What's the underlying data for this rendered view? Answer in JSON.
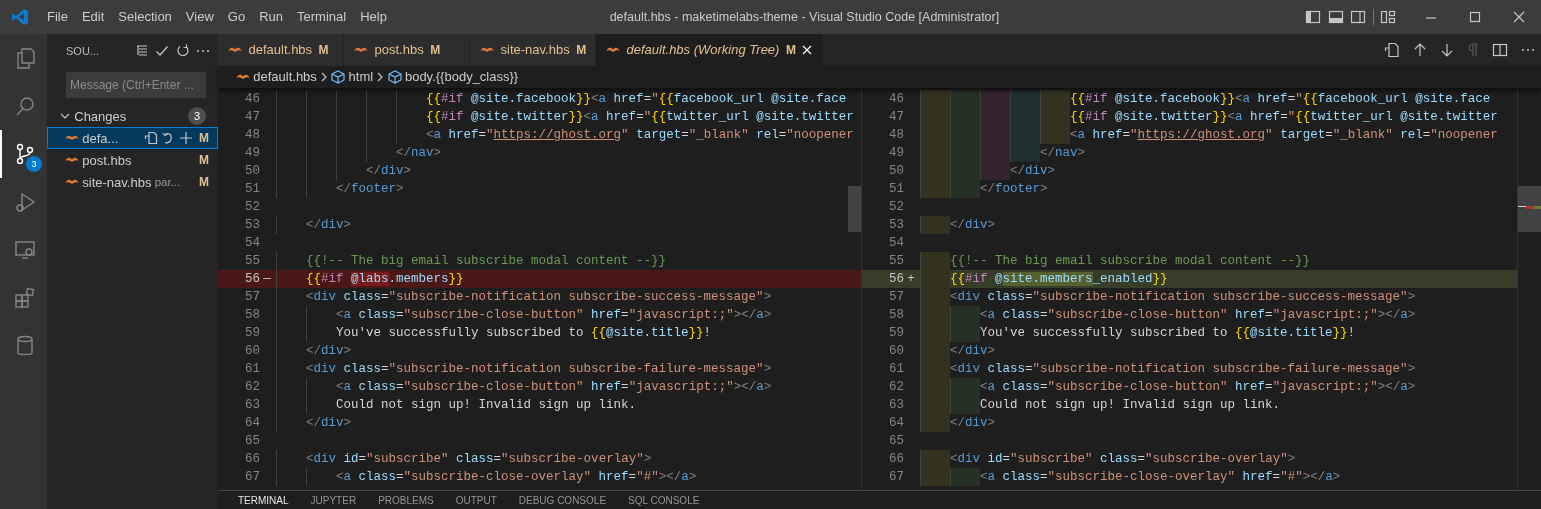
{
  "title_bar": {
    "menus": [
      "File",
      "Edit",
      "Selection",
      "View",
      "Go",
      "Run",
      "Terminal",
      "Help"
    ],
    "title": "default.hbs - maketimelabs-theme - Visual Studio Code [Administrator]"
  },
  "activity_bar": {
    "items": [
      {
        "selected": false
      },
      {
        "selected": false
      },
      {
        "selected": true,
        "badge": "3"
      },
      {
        "selected": false
      },
      {
        "selected": false
      },
      {
        "selected": false
      },
      {
        "selected": false
      }
    ]
  },
  "sidebar": {
    "title": "SOU...",
    "message": {
      "placeholder": "Message (Ctrl+Enter ..."
    },
    "section": {
      "label": "Changes",
      "expanded": true,
      "count": "3",
      "files": [
        {
          "name": "defa...",
          "status": "M",
          "selected": true
        },
        {
          "name": "post.hbs",
          "status": "M",
          "selected": false
        },
        {
          "name": "site-nav.hbs",
          "detail": "par...",
          "status": "M",
          "selected": false
        }
      ]
    }
  },
  "tabs": [
    {
      "label": "default.hbs",
      "status": "M",
      "selected": false,
      "preview": false
    },
    {
      "label": "post.hbs",
      "status": "M",
      "selected": false,
      "preview": false
    },
    {
      "label": "site-nav.hbs",
      "status": "M",
      "selected": false,
      "preview": false
    },
    {
      "label": "default.hbs (Working Tree)",
      "status": "M",
      "selected": true,
      "preview": true
    }
  ],
  "breadcrumbs": [
    {
      "label": "default.hbs",
      "kind": "file"
    },
    {
      "label": "html",
      "kind": "symbol"
    },
    {
      "label": "body.{{body_class}}",
      "kind": "symbol"
    }
  ],
  "diff": {
    "left": {
      "indent_rainbow": false,
      "lines": [
        {
          "number": "46",
          "kind": "unchanged",
          "tokens": [
            {
              "kind": "brace",
              "text": "                    {{"
            },
            {
              "kind": "keyword",
              "text": "#if"
            },
            {
              "kind": "var",
              "text": " @site.facebook"
            },
            {
              "kind": "brace",
              "text": "}}"
            },
            {
              "kind": "punct",
              "text": "<"
            },
            {
              "kind": "tag",
              "text": "a"
            },
            {
              "kind": "attr",
              "text": " href"
            },
            {
              "kind": "plain",
              "text": "="
            },
            {
              "kind": "string",
              "text": "\""
            },
            {
              "kind": "brace",
              "text": "{{"
            },
            {
              "kind": "var",
              "text": "facebook_url @site.face"
            }
          ]
        },
        {
          "number": "47",
          "kind": "unchanged",
          "tokens": [
            {
              "kind": "brace",
              "text": "                    {{"
            },
            {
              "kind": "keyword",
              "text": "#if"
            },
            {
              "kind": "var",
              "text": " @site.twitter"
            },
            {
              "kind": "brace",
              "text": "}}"
            },
            {
              "kind": "punct",
              "text": "<"
            },
            {
              "kind": "tag",
              "text": "a"
            },
            {
              "kind": "attr",
              "text": " href"
            },
            {
              "kind": "plain",
              "text": "="
            },
            {
              "kind": "string",
              "text": "\""
            },
            {
              "kind": "brace",
              "text": "{{"
            },
            {
              "kind": "var",
              "text": "twitter_url @site.twitter"
            }
          ]
        },
        {
          "number": "48",
          "kind": "unchanged",
          "tokens": [
            {
              "kind": "punct",
              "text": "                    <"
            },
            {
              "kind": "tag",
              "text": "a"
            },
            {
              "kind": "attr",
              "text": " href"
            },
            {
              "kind": "plain",
              "text": "="
            },
            {
              "kind": "string",
              "text": "\""
            },
            {
              "kind": "link",
              "text": "https://ghost.org"
            },
            {
              "kind": "string",
              "text": "\""
            },
            {
              "kind": "attr",
              "text": " target"
            },
            {
              "kind": "plain",
              "text": "="
            },
            {
              "kind": "string",
              "text": "\"_blank\""
            },
            {
              "kind": "attr",
              "text": " rel"
            },
            {
              "kind": "plain",
              "text": "="
            },
            {
              "kind": "string",
              "text": "\"noopener"
            }
          ]
        },
        {
          "number": "49",
          "kind": "unchanged",
          "tokens": [
            {
              "kind": "punct",
              "text": "                </"
            },
            {
              "kind": "tag",
              "text": "nav"
            },
            {
              "kind": "punct",
              "text": ">"
            }
          ]
        },
        {
          "number": "50",
          "kind": "unchanged",
          "tokens": [
            {
              "kind": "punct",
              "text": "            </"
            },
            {
              "kind": "tag",
              "text": "div"
            },
            {
              "kind": "punct",
              "text": ">"
            }
          ]
        },
        {
          "number": "51",
          "kind": "unchanged",
          "tokens": [
            {
              "kind": "punct",
              "text": "        </"
            },
            {
              "kind": "tag",
              "text": "footer"
            },
            {
              "kind": "punct",
              "text": ">"
            }
          ]
        },
        {
          "number": "52",
          "kind": "unchanged"
        },
        {
          "number": "53",
          "kind": "unchanged",
          "tokens": [
            {
              "kind": "punct",
              "text": "    </"
            },
            {
              "kind": "tag",
              "text": "div"
            },
            {
              "kind": "punct",
              "text": ">"
            }
          ]
        },
        {
          "number": "54",
          "kind": "unchanged"
        },
        {
          "number": "55",
          "kind": "unchanged",
          "tokens": [
            {
              "kind": "comment",
              "text": "    {{!-- The big email subscribe modal content --}}"
            }
          ]
        },
        {
          "number": "56",
          "kind": "removed",
          "marker": "—",
          "tokens": [
            {
              "kind": "brace",
              "text": "    {{"
            },
            {
              "kind": "keyword",
              "text": "#if "
            },
            {
              "kind": "deleted",
              "text": "@labs"
            },
            {
              "kind": "var",
              "text": ".members"
            },
            {
              "kind": "brace",
              "text": "}}"
            }
          ]
        },
        {
          "number": "57",
          "kind": "unchanged",
          "tokens": [
            {
              "kind": "punct",
              "text": "    <"
            },
            {
              "kind": "tag",
              "text": "div"
            },
            {
              "kind": "attr",
              "text": " class"
            },
            {
              "kind": "plain",
              "text": "="
            },
            {
              "kind": "string",
              "text": "\"subscribe-notification subscribe-success-message\""
            },
            {
              "kind": "punct",
              "text": ">"
            }
          ]
        },
        {
          "number": "58",
          "kind": "unchanged",
          "tokens": [
            {
              "kind": "punct",
              "text": "        <"
            },
            {
              "kind": "tag",
              "text": "a"
            },
            {
              "kind": "attr",
              "text": " class"
            },
            {
              "kind": "plain",
              "text": "="
            },
            {
              "kind": "string",
              "text": "\"subscribe-close-button\""
            },
            {
              "kind": "attr",
              "text": " href"
            },
            {
              "kind": "plain",
              "text": "="
            },
            {
              "kind": "string",
              "text": "\"javascript:;\""
            },
            {
              "kind": "punct",
              "text": "></"
            },
            {
              "kind": "tag",
              "text": "a"
            },
            {
              "kind": "punct",
              "text": ">"
            }
          ]
        },
        {
          "number": "59",
          "kind": "unchanged",
          "tokens": [
            {
              "kind": "plain",
              "text": "        You've successfully subscribed to "
            },
            {
              "kind": "brace",
              "text": "{{"
            },
            {
              "kind": "var",
              "text": "@site.title"
            },
            {
              "kind": "brace",
              "text": "}}"
            },
            {
              "kind": "plain",
              "text": "!"
            }
          ]
        },
        {
          "number": "60",
          "kind": "unchanged",
          "tokens": [
            {
              "kind": "punct",
              "text": "    </"
            },
            {
              "kind": "tag",
              "text": "div"
            },
            {
              "kind": "punct",
              "text": ">"
            }
          ]
        },
        {
          "number": "61",
          "kind": "unchanged",
          "tokens": [
            {
              "kind": "punct",
              "text": "    <"
            },
            {
              "kind": "tag",
              "text": "div"
            },
            {
              "kind": "attr",
              "text": " class"
            },
            {
              "kind": "plain",
              "text": "="
            },
            {
              "kind": "string",
              "text": "\"subscribe-notification subscribe-failure-message\""
            },
            {
              "kind": "punct",
              "text": ">"
            }
          ]
        },
        {
          "number": "62",
          "kind": "unchanged",
          "tokens": [
            {
              "kind": "punct",
              "text": "        <"
            },
            {
              "kind": "tag",
              "text": "a"
            },
            {
              "kind": "attr",
              "text": " class"
            },
            {
              "kind": "plain",
              "text": "="
            },
            {
              "kind": "string",
              "text": "\"subscribe-close-button\""
            },
            {
              "kind": "attr",
              "text": " href"
            },
            {
              "kind": "plain",
              "text": "="
            },
            {
              "kind": "string",
              "text": "\"javascript:;\""
            },
            {
              "kind": "punct",
              "text": "></"
            },
            {
              "kind": "tag",
              "text": "a"
            },
            {
              "kind": "punct",
              "text": ">"
            }
          ]
        },
        {
          "number": "63",
          "kind": "unchanged",
          "tokens": [
            {
              "kind": "plain",
              "text": "        Could not sign up! Invalid sign up link."
            }
          ]
        },
        {
          "number": "64",
          "kind": "unchanged",
          "tokens": [
            {
              "kind": "punct",
              "text": "    </"
            },
            {
              "kind": "tag",
              "text": "div"
            },
            {
              "kind": "punct",
              "text": ">"
            }
          ]
        },
        {
          "number": "65",
          "kind": "unchanged"
        },
        {
          "number": "66",
          "kind": "unchanged",
          "tokens": [
            {
              "kind": "punct",
              "text": "    <"
            },
            {
              "kind": "tag",
              "text": "div"
            },
            {
              "kind": "attr",
              "text": " id"
            },
            {
              "kind": "plain",
              "text": "="
            },
            {
              "kind": "string",
              "text": "\"subscribe\""
            },
            {
              "kind": "attr",
              "text": " class"
            },
            {
              "kind": "plain",
              "text": "="
            },
            {
              "kind": "string",
              "text": "\"subscribe-overlay\""
            },
            {
              "kind": "punct",
              "text": ">"
            }
          ]
        },
        {
          "number": "67",
          "kind": "unchanged",
          "tokens": [
            {
              "kind": "punct",
              "text": "        <"
            },
            {
              "kind": "tag",
              "text": "a"
            },
            {
              "kind": "attr",
              "text": " class"
            },
            {
              "kind": "plain",
              "text": "="
            },
            {
              "kind": "string",
              "text": "\"subscribe-close-overlay\""
            },
            {
              "kind": "attr",
              "text": " href"
            },
            {
              "kind": "plain",
              "text": "="
            },
            {
              "kind": "string",
              "text": "\"#\""
            },
            {
              "kind": "punct",
              "text": "></"
            },
            {
              "kind": "tag",
              "text": "a"
            },
            {
              "kind": "punct",
              "text": ">"
            }
          ]
        }
      ]
    },
    "right": {
      "indent_rainbow": true,
      "lines": [
        {
          "number": "46",
          "kind": "unchanged",
          "tokens": [
            {
              "kind": "brace",
              "text": "                    {{"
            },
            {
              "kind": "keyword",
              "text": "#if"
            },
            {
              "kind": "var",
              "text": " @site.facebook"
            },
            {
              "kind": "brace",
              "text": "}}"
            },
            {
              "kind": "punct",
              "text": "<"
            },
            {
              "kind": "tag",
              "text": "a"
            },
            {
              "kind": "attr",
              "text": " href"
            },
            {
              "kind": "plain",
              "text": "="
            },
            {
              "kind": "string",
              "text": "\""
            },
            {
              "kind": "brace",
              "text": "{{"
            },
            {
              "kind": "var",
              "text": "facebook_url @site.face"
            }
          ]
        },
        {
          "number": "47",
          "kind": "unchanged",
          "tokens": [
            {
              "kind": "brace",
              "text": "                    {{"
            },
            {
              "kind": "keyword",
              "text": "#if"
            },
            {
              "kind": "var",
              "text": " @site.twitter"
            },
            {
              "kind": "brace",
              "text": "}}"
            },
            {
              "kind": "punct",
              "text": "<"
            },
            {
              "kind": "tag",
              "text": "a"
            },
            {
              "kind": "attr",
              "text": " href"
            },
            {
              "kind": "plain",
              "text": "="
            },
            {
              "kind": "string",
              "text": "\""
            },
            {
              "kind": "brace",
              "text": "{{"
            },
            {
              "kind": "var",
              "text": "twitter_url @site.twitter"
            }
          ]
        },
        {
          "number": "48",
          "kind": "unchanged",
          "tokens": [
            {
              "kind": "punct",
              "text": "                    <"
            },
            {
              "kind": "tag",
              "text": "a"
            },
            {
              "kind": "attr",
              "text": " href"
            },
            {
              "kind": "plain",
              "text": "="
            },
            {
              "kind": "string",
              "text": "\""
            },
            {
              "kind": "link",
              "text": "https://ghost.org"
            },
            {
              "kind": "string",
              "text": "\""
            },
            {
              "kind": "attr",
              "text": " target"
            },
            {
              "kind": "plain",
              "text": "="
            },
            {
              "kind": "string",
              "text": "\"_blank\""
            },
            {
              "kind": "attr",
              "text": " rel"
            },
            {
              "kind": "plain",
              "text": "="
            },
            {
              "kind": "string",
              "text": "\"noopener"
            }
          ]
        },
        {
          "number": "49",
          "kind": "unchanged",
          "tokens": [
            {
              "kind": "punct",
              "text": "                </"
            },
            {
              "kind": "tag",
              "text": "nav"
            },
            {
              "kind": "punct",
              "text": ">"
            }
          ]
        },
        {
          "number": "50",
          "kind": "unchanged",
          "tokens": [
            {
              "kind": "punct",
              "text": "            </"
            },
            {
              "kind": "tag",
              "text": "div"
            },
            {
              "kind": "punct",
              "text": ">"
            }
          ]
        },
        {
          "number": "51",
          "kind": "unchanged",
          "tokens": [
            {
              "kind": "punct",
              "text": "        </"
            },
            {
              "kind": "tag",
              "text": "footer"
            },
            {
              "kind": "punct",
              "text": ">"
            }
          ]
        },
        {
          "number": "52",
          "kind": "unchanged"
        },
        {
          "number": "53",
          "kind": "unchanged",
          "tokens": [
            {
              "kind": "punct",
              "text": "    </"
            },
            {
              "kind": "tag",
              "text": "div"
            },
            {
              "kind": "punct",
              "text": ">"
            }
          ]
        },
        {
          "number": "54",
          "kind": "unchanged"
        },
        {
          "number": "55",
          "kind": "unchanged",
          "tokens": [
            {
              "kind": "comment",
              "text": "    {{!-- The big email subscribe modal content --}}"
            }
          ]
        },
        {
          "number": "56",
          "kind": "added",
          "marker": "+",
          "tokens": [
            {
              "kind": "brace",
              "text": "    {{"
            },
            {
              "kind": "keyword",
              "text": "#if"
            },
            {
              "kind": "var",
              "text": " @"
            },
            {
              "kind": "inserted",
              "text": "site.members"
            },
            {
              "kind": "var",
              "text": "_enabled"
            },
            {
              "kind": "brace",
              "text": "}}"
            }
          ]
        },
        {
          "number": "57",
          "kind": "unchanged",
          "tokens": [
            {
              "kind": "punct",
              "text": "    <"
            },
            {
              "kind": "tag",
              "text": "div"
            },
            {
              "kind": "attr",
              "text": " class"
            },
            {
              "kind": "plain",
              "text": "="
            },
            {
              "kind": "string",
              "text": "\"subscribe-notification subscribe-success-message\""
            },
            {
              "kind": "punct",
              "text": ">"
            }
          ]
        },
        {
          "number": "58",
          "kind": "unchanged",
          "tokens": [
            {
              "kind": "punct",
              "text": "        <"
            },
            {
              "kind": "tag",
              "text": "a"
            },
            {
              "kind": "attr",
              "text": " class"
            },
            {
              "kind": "plain",
              "text": "="
            },
            {
              "kind": "string",
              "text": "\"subscribe-close-button\""
            },
            {
              "kind": "attr",
              "text": " href"
            },
            {
              "kind": "plain",
              "text": "="
            },
            {
              "kind": "string",
              "text": "\"javascript:;\""
            },
            {
              "kind": "punct",
              "text": "></"
            },
            {
              "kind": "tag",
              "text": "a"
            },
            {
              "kind": "punct",
              "text": ">"
            }
          ]
        },
        {
          "number": "59",
          "kind": "unchanged",
          "tokens": [
            {
              "kind": "plain",
              "text": "        You've successfully subscribed to "
            },
            {
              "kind": "brace",
              "text": "{{"
            },
            {
              "kind": "var",
              "text": "@site.title"
            },
            {
              "kind": "brace",
              "text": "}}"
            },
            {
              "kind": "plain",
              "text": "!"
            }
          ]
        },
        {
          "number": "60",
          "kind": "unchanged",
          "tokens": [
            {
              "kind": "punct",
              "text": "    </"
            },
            {
              "kind": "tag",
              "text": "div"
            },
            {
              "kind": "punct",
              "text": ">"
            }
          ]
        },
        {
          "number": "61",
          "kind": "unchanged",
          "tokens": [
            {
              "kind": "punct",
              "text": "    <"
            },
            {
              "kind": "tag",
              "text": "div"
            },
            {
              "kind": "attr",
              "text": " class"
            },
            {
              "kind": "plain",
              "text": "="
            },
            {
              "kind": "string",
              "text": "\"subscribe-notification subscribe-failure-message\""
            },
            {
              "kind": "punct",
              "text": ">"
            }
          ]
        },
        {
          "number": "62",
          "kind": "unchanged",
          "tokens": [
            {
              "kind": "punct",
              "text": "        <"
            },
            {
              "kind": "tag",
              "text": "a"
            },
            {
              "kind": "attr",
              "text": " class"
            },
            {
              "kind": "plain",
              "text": "="
            },
            {
              "kind": "string",
              "text": "\"subscribe-close-button\""
            },
            {
              "kind": "attr",
              "text": " href"
            },
            {
              "kind": "plain",
              "text": "="
            },
            {
              "kind": "string",
              "text": "\"javascript:;\""
            },
            {
              "kind": "punct",
              "text": "></"
            },
            {
              "kind": "tag",
              "text": "a"
            },
            {
              "kind": "punct",
              "text": ">"
            }
          ]
        },
        {
          "number": "63",
          "kind": "unchanged",
          "tokens": [
            {
              "kind": "plain",
              "text": "        Could not sign up! Invalid sign up link."
            }
          ]
        },
        {
          "number": "64",
          "kind": "unchanged",
          "tokens": [
            {
              "kind": "punct",
              "text": "    </"
            },
            {
              "kind": "tag",
              "text": "div"
            },
            {
              "kind": "punct",
              "text": ">"
            }
          ]
        },
        {
          "number": "65",
          "kind": "unchanged"
        },
        {
          "number": "66",
          "kind": "unchanged",
          "tokens": [
            {
              "kind": "punct",
              "text": "    <"
            },
            {
              "kind": "tag",
              "text": "div"
            },
            {
              "kind": "attr",
              "text": " id"
            },
            {
              "kind": "plain",
              "text": "="
            },
            {
              "kind": "string",
              "text": "\"subscribe\""
            },
            {
              "kind": "attr",
              "text": " class"
            },
            {
              "kind": "plain",
              "text": "="
            },
            {
              "kind": "string",
              "text": "\"subscribe-overlay\""
            },
            {
              "kind": "punct",
              "text": ">"
            }
          ]
        },
        {
          "number": "67",
          "kind": "unchanged",
          "tokens": [
            {
              "kind": "punct",
              "text": "        <"
            },
            {
              "kind": "tag",
              "text": "a"
            },
            {
              "kind": "attr",
              "text": " class"
            },
            {
              "kind": "plain",
              "text": "="
            },
            {
              "kind": "string",
              "text": "\"subscribe-close-overlay\""
            },
            {
              "kind": "attr",
              "text": " href"
            },
            {
              "kind": "plain",
              "text": "="
            },
            {
              "kind": "string",
              "text": "\"#\""
            },
            {
              "kind": "punct",
              "text": "></"
            },
            {
              "kind": "tag",
              "text": "a"
            },
            {
              "kind": "punct",
              "text": ">"
            }
          ]
        }
      ]
    }
  },
  "panel_tabs": [
    {
      "label": "TERMINAL",
      "selected": true
    },
    {
      "label": "JUPYTER",
      "selected": false
    },
    {
      "label": "PROBLEMS",
      "selected": false
    },
    {
      "label": "OUTPUT",
      "selected": false
    },
    {
      "label": "DEBUG CONSOLE",
      "selected": false
    },
    {
      "label": "SQL CONSOLE",
      "selected": false
    }
  ]
}
